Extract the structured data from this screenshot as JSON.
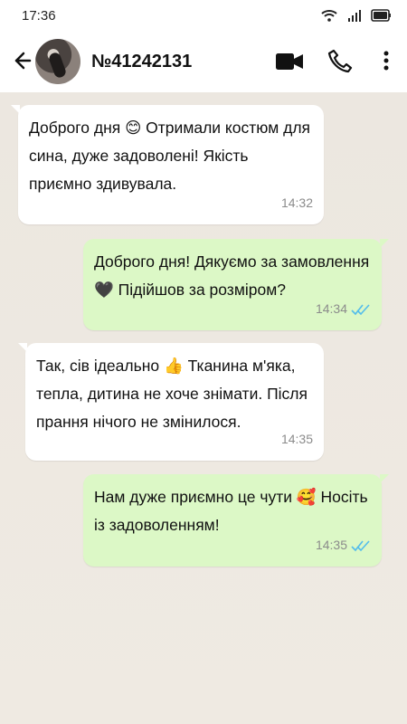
{
  "status": {
    "time": "17:36",
    "icons": [
      "wifi-icon",
      "signal-icon",
      "battery-icon"
    ]
  },
  "header": {
    "contact_name": "№41242131",
    "icons": [
      "back-arrow-icon",
      "avatar",
      "video-call-icon",
      "phone-icon",
      "more-vert-icon"
    ]
  },
  "messages": [
    {
      "direction": "incoming",
      "text": "Доброго дня 😊 Отримали костюм для сина, дуже задоволені! Якість приємно здивувала.",
      "time": "14:32"
    },
    {
      "direction": "outgoing",
      "text": "Доброго дня! Дякуємо за замовлення 🖤  Підійшов за розміром?",
      "time": "14:34",
      "status": "read"
    },
    {
      "direction": "incoming",
      "text": "Так, сів ідеально 👍 Тканина м'яка, тепла, дитина не хоче знімати. Після прання нічого не змінилося.",
      "time": "14:35"
    },
    {
      "direction": "outgoing",
      "text": "Нам дуже приємно це чути 🥰 Носіть із задоволенням!",
      "time": "14:35",
      "status": "read"
    }
  ],
  "colors": {
    "incoming_bubble": "#ffffff",
    "outgoing_bubble": "#dcf8c6",
    "chat_background": "#efeae2",
    "read_check": "#53bdeb"
  }
}
